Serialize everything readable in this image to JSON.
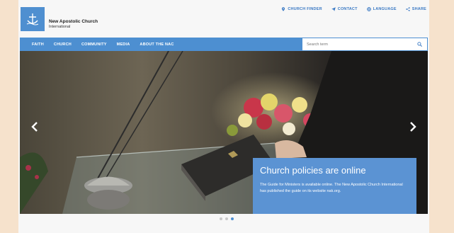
{
  "header": {
    "org_name": "New Apostolic Church",
    "org_sub": "International",
    "links": [
      {
        "label": "CHURCH FINDER",
        "icon": "location-pin-icon"
      },
      {
        "label": "CONTACT",
        "icon": "paper-plane-icon"
      },
      {
        "label": "LANGUAGE",
        "icon": "globe-icon"
      },
      {
        "label": "SHARE",
        "icon": "share-icon"
      }
    ]
  },
  "nav": {
    "items": [
      "FAITH",
      "CHURCH",
      "COMMUNITY",
      "MEDIA",
      "ABOUT THE NAC"
    ],
    "search_placeholder": "Search term"
  },
  "hero": {
    "caption_title": "Church policies are online",
    "caption_text": "The Guide for Ministers is available online. The New Apostolic Church International has published the guide on its website nak.org.",
    "slides_total": 3,
    "active_slide": 3
  },
  "colors": {
    "accent": "#4d8fd1",
    "caption_bg": "#5b93d3",
    "page_bg": "#f6e2cc"
  }
}
